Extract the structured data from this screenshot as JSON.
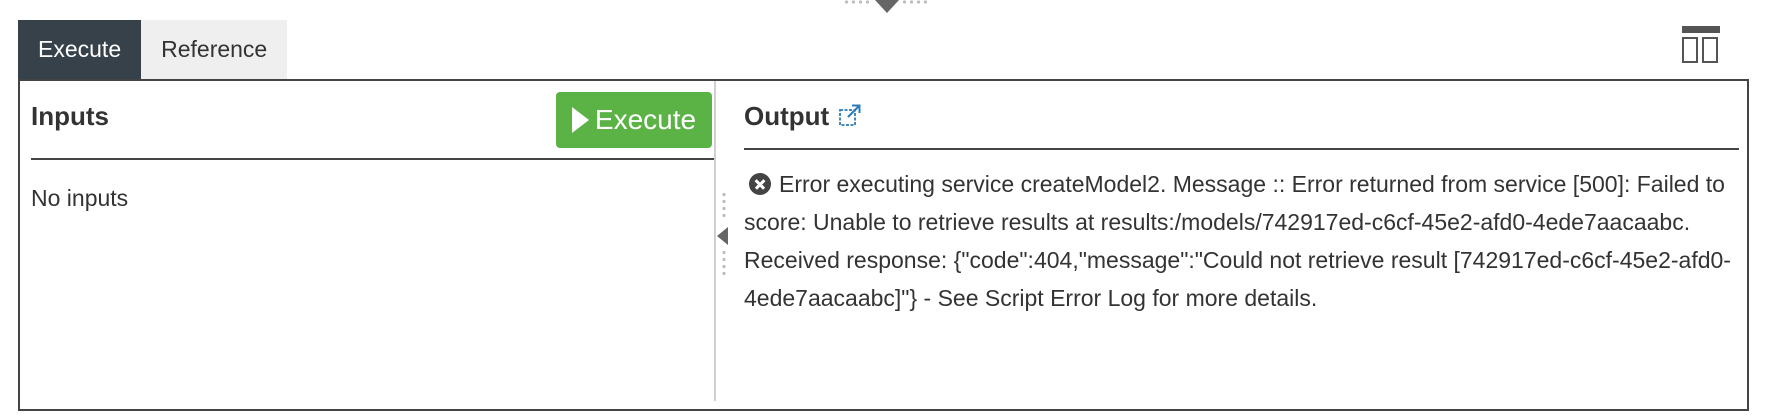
{
  "tabs": [
    {
      "label": "Execute",
      "active": true
    },
    {
      "label": "Reference",
      "active": false
    }
  ],
  "icons": {
    "layout": "layout-columns-icon",
    "popout": "external-link-icon",
    "error": "error-circle-x-icon",
    "play": "play-icon"
  },
  "inputs": {
    "title": "Inputs",
    "execute_button_label": "Execute",
    "empty_text": "No inputs"
  },
  "output": {
    "title": "Output",
    "error_message": "Error executing service createModel2. Message :: Error returned from service [500]: Failed to score: Unable to retrieve results at results:/models/742917ed-c6cf-45e2-afd0-4ede7aacaabc. Received response: {\"code\":404,\"message\":\"Could not retrieve result [742917ed-c6cf-45e2-afd0-4ede7aacaabc]\"} - See Script Error Log for more details."
  },
  "colors": {
    "active_tab": "#37414a",
    "execute_button": "#5bb346",
    "popout_link": "#2b7bb9"
  }
}
